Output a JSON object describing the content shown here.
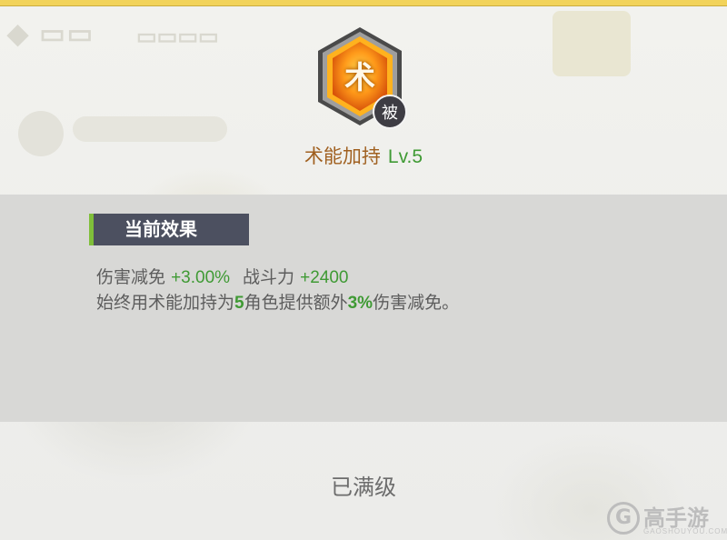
{
  "colors": {
    "accent_green": "#3f9a34",
    "skill_name_brown": "#a06020",
    "header_bg": "#4c5060",
    "header_accent": "#7fbf3a",
    "band_bg": "#d8d8d6",
    "badge_bg": "#3e3d44"
  },
  "skill": {
    "icon_char": "术",
    "icon": "hexagon-skill-icon",
    "badge": "被",
    "name": "术能加持",
    "level": "Lv.5"
  },
  "effect": {
    "header": "当前效果",
    "stat1_label": "伤害减免",
    "stat1_value": "+3.00%",
    "stat2_label": "战斗力",
    "stat2_value": "+2400",
    "desc_part1": "始终用术能加持为",
    "desc_num1": "5",
    "desc_part2": "角色提供额外",
    "desc_num2": "3%",
    "desc_part3": "伤害减免。"
  },
  "status": {
    "maxed": "已满级"
  },
  "watermark": {
    "text": "高手游",
    "sub": "GAOSHOUYOU.COM"
  }
}
